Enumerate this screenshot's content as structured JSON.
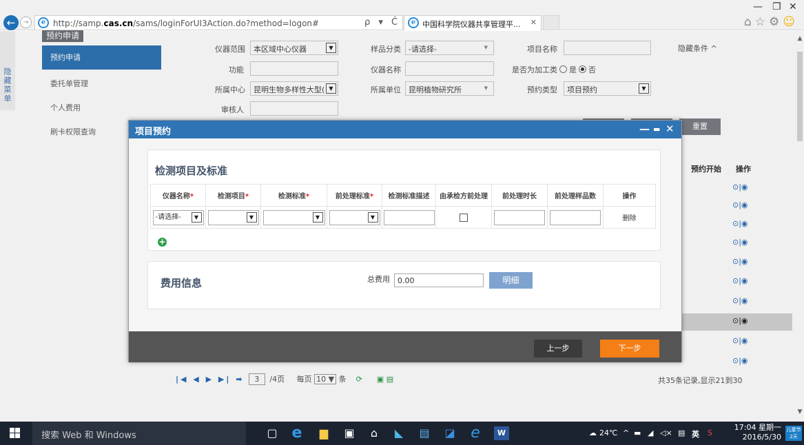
{
  "browser": {
    "url_prefix": "http://samp.",
    "url_domain": "cas.cn",
    "url_rest": "/sams/loginForUI3Action.do?method=logon#",
    "tab_title": "中国科学院仪器共享管理平...",
    "addr_tools": "ρ ▾ Ċ"
  },
  "sidebar": {
    "hide_label": "隐藏菜单",
    "header": "预约申请",
    "items": [
      {
        "label": "预约申请"
      },
      {
        "label": "委托单管理"
      },
      {
        "label": "个人费用"
      },
      {
        "label": "刷卡权限查询"
      }
    ]
  },
  "filters": {
    "instrument_scope_label": "仪器范围",
    "instrument_scope_value": "本区域中心仪器",
    "sample_class_label": "样品分类",
    "sample_class_value": "-请选择-",
    "project_name_label": "项目名称",
    "hide_conditions": "隐藏条件 ^",
    "function_label": "功能",
    "instrument_name_label": "仪器名称",
    "processing_label": "是否为加工类",
    "yes": "是",
    "no": "否",
    "center_label": "所属中心",
    "center_value": "昆明生物多样性大型(",
    "unit_label": "所属单位",
    "unit_value": "昆明植物研究所",
    "booking_type_label": "预约类型",
    "booking_type_value": "项目预约",
    "reviewer_label": "审核人",
    "reset_button": "重置"
  },
  "table_bg": {
    "col_booking_start": "预约开始",
    "col_ops": "操作",
    "ops_symbol": "⊙|◉"
  },
  "pager": {
    "current_page": "3",
    "total_pages": "/4页",
    "per_page_label": "每页",
    "per_page_value": "10",
    "per_page_unit": "条",
    "summary": "共35条记录,显示21到30"
  },
  "modal": {
    "title": "项目预约",
    "controls": "— ▭ ✕",
    "section1_title": "检测项目及标准",
    "columns": [
      {
        "label": "仪器名称",
        "required": "*"
      },
      {
        "label": "检测项目",
        "required": "*"
      },
      {
        "label": "检测标准",
        "required": "*"
      },
      {
        "label": "前处理标准",
        "required": "*"
      },
      {
        "label": "检测标准描述",
        "required": ""
      },
      {
        "label": "由承检方前处理",
        "required": ""
      },
      {
        "label": "前处理时长",
        "required": ""
      },
      {
        "label": "前处理样品数",
        "required": ""
      },
      {
        "label": "操作",
        "required": ""
      }
    ],
    "row_instrument_value": "-请选择-",
    "row_delete": "删除",
    "section2_title": "费用信息",
    "total_fee_label": "总费用",
    "total_fee_value": "0.00",
    "detail_button": "明细",
    "prev_button": "上一步",
    "next_button": "下一步"
  },
  "taskbar": {
    "search_placeholder": "搜索 Web 和 Windows",
    "temperature": "24℃",
    "ime": "英",
    "time": "17:04 星期一",
    "date": "2016/5/30",
    "notif_top": "儿童节",
    "notif_bottom": "2天"
  }
}
